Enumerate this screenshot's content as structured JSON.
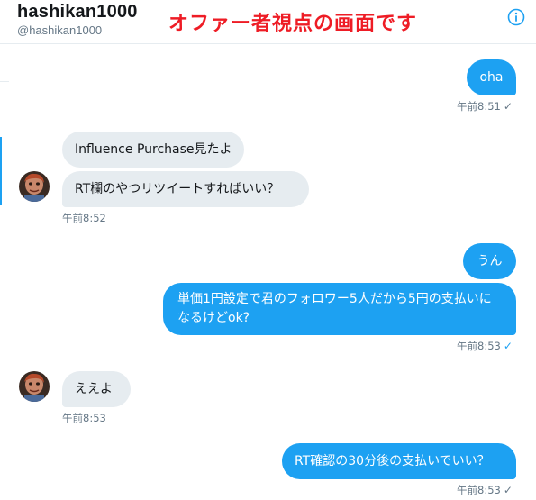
{
  "header": {
    "display_name": "hashikan1000",
    "handle": "@hashikan1000",
    "annotation": "オファー者視点の画面です",
    "info_icon": "info-icon"
  },
  "colors": {
    "accent": "#1da1f2",
    "received_bubble": "#e6ecf0",
    "annotation": "#ee1c25",
    "muted_text": "#657786"
  },
  "messages": [
    {
      "side": "sent",
      "text": "oha",
      "time": "午前8:51",
      "read": "✓"
    },
    {
      "side": "received",
      "text": "Influence Purchase見たよ"
    },
    {
      "side": "received",
      "text": "RT欄のやつリツイートすればいい？",
      "time": "午前8:52"
    },
    {
      "side": "sent",
      "text": "うん"
    },
    {
      "side": "sent",
      "text": "単価1円設定で君のフォロワー5人だから5円の支払いになるけどok?",
      "time": "午前8:53",
      "read": "✓"
    },
    {
      "side": "received",
      "text": "ええよ",
      "time": "午前8:53"
    },
    {
      "side": "sent",
      "text": "RT確認の30分後の支払いでいい？",
      "time": "午前8:53",
      "read": "✓"
    }
  ]
}
